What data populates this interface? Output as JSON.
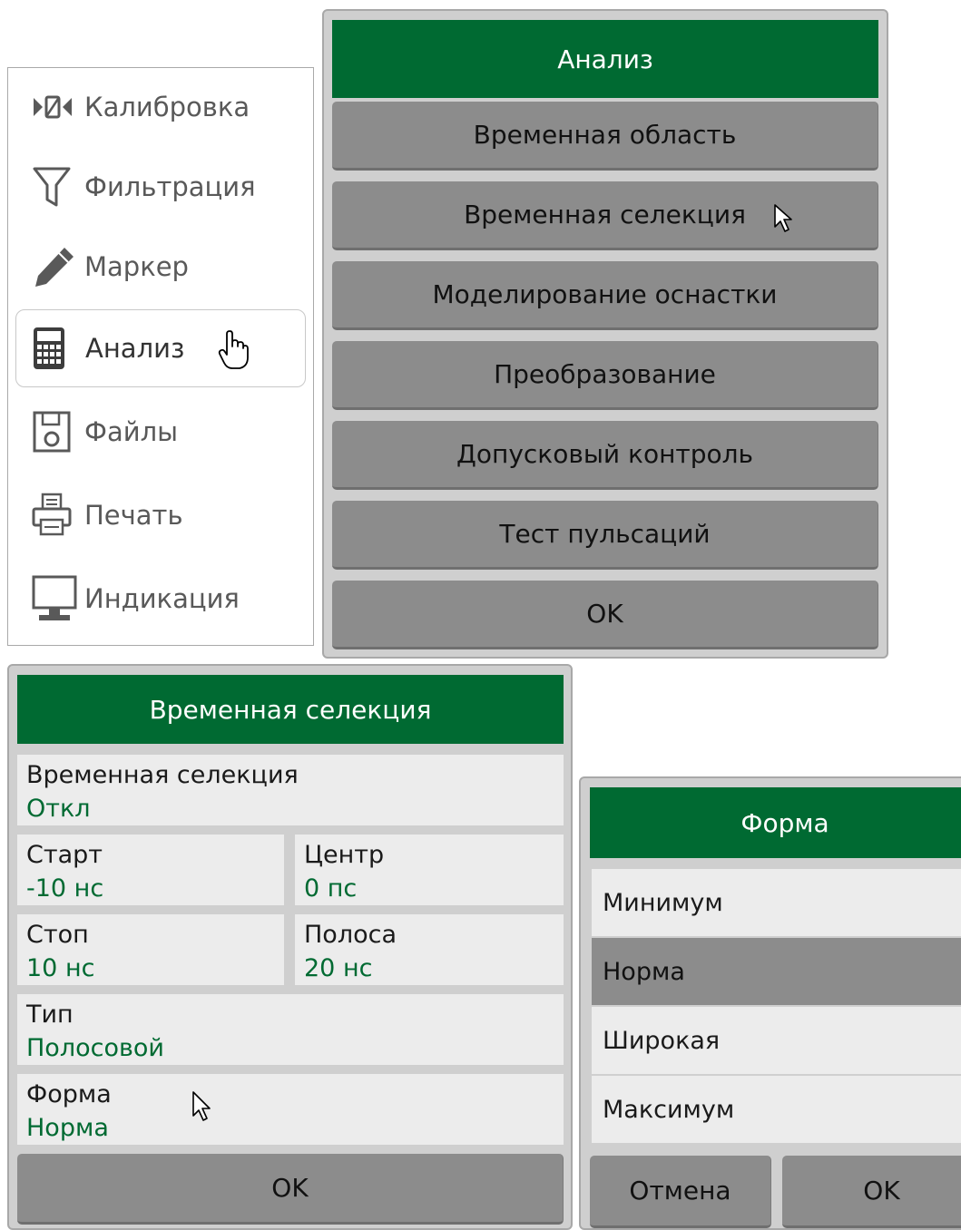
{
  "nav": {
    "items": [
      {
        "label": "Калибровка",
        "icon": "calibration-icon"
      },
      {
        "label": "Фильтрация",
        "icon": "filter-icon"
      },
      {
        "label": "Маркер",
        "icon": "pencil-icon"
      },
      {
        "label": "Анализ",
        "icon": "calculator-icon"
      },
      {
        "label": "Файлы",
        "icon": "floppy-disk-icon"
      },
      {
        "label": "Печать",
        "icon": "printer-icon"
      },
      {
        "label": "Индикация",
        "icon": "monitor-icon"
      }
    ],
    "active_index": 3
  },
  "analysis_menu": {
    "title": "Анализ",
    "items": [
      "Временная область",
      "Временная селекция",
      "Моделирование оснастки",
      "Преобразование",
      "Допусковый контроль",
      "Тест пульсаций"
    ],
    "ok": "OK"
  },
  "gating": {
    "title": "Временная селекция",
    "gating_label": "Временная селекция",
    "gating_value": "Откл",
    "start_label": "Старт",
    "start_value": "-10 нс",
    "center_label": "Центр",
    "center_value": "0 пс",
    "stop_label": "Стоп",
    "stop_value": "10 нс",
    "span_label": "Полоса",
    "span_value": "20 нс",
    "type_label": "Тип",
    "type_value": "Полосовой",
    "shape_label": "Форма",
    "shape_value": "Норма",
    "ok": "OK"
  },
  "shape": {
    "title": "Форма",
    "options": [
      "Минимум",
      "Норма",
      "Широкая",
      "Максимум"
    ],
    "selected_index": 1,
    "cancel": "Отмена",
    "ok": "OK"
  },
  "colors": {
    "header_green": "#006a32",
    "value_green": "#006a32",
    "button_gray": "#8c8c8c"
  }
}
